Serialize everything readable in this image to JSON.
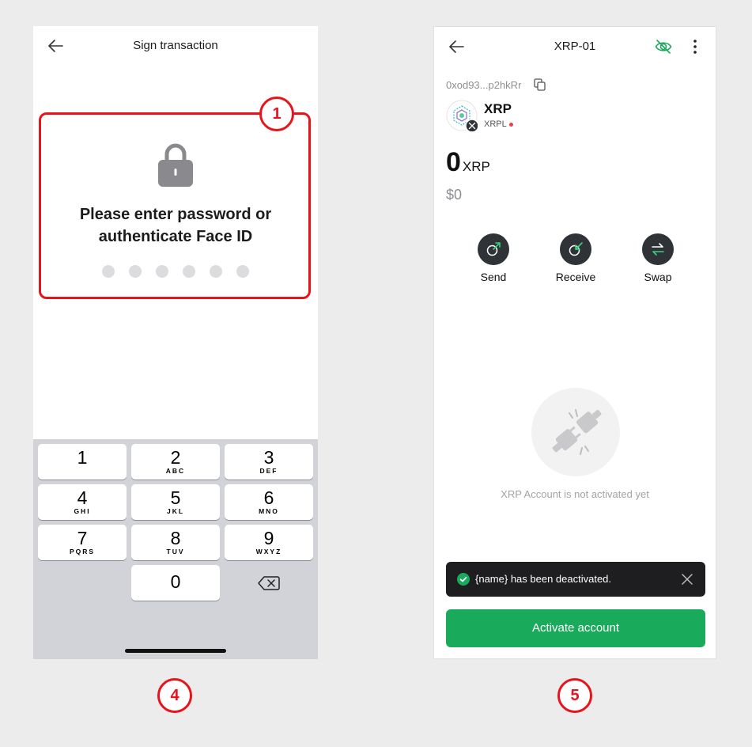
{
  "colors": {
    "accent_red": "#e8141c",
    "activate_green": "#1aaa5c",
    "toast_bg": "#1e1e20",
    "action_circle": "#2f3236",
    "muted_text": "#8e8e93"
  },
  "callouts": {
    "one": "1",
    "four": "4",
    "five": "5"
  },
  "sign_screen": {
    "title": "Sign transaction",
    "back_icon": "arrow-left-icon",
    "lock_icon": "lock-icon",
    "message": "Please enter password or authenticate Face ID",
    "pin_dot_count": 6,
    "keypad": [
      {
        "num": "1",
        "letters": ""
      },
      {
        "num": "2",
        "letters": "ABC"
      },
      {
        "num": "3",
        "letters": "DEF"
      },
      {
        "num": "4",
        "letters": "GHI"
      },
      {
        "num": "5",
        "letters": "JKL"
      },
      {
        "num": "6",
        "letters": "MNO"
      },
      {
        "num": "7",
        "letters": "PQRS"
      },
      {
        "num": "8",
        "letters": "TUV"
      },
      {
        "num": "9",
        "letters": "WXYZ"
      },
      {
        "num": "0",
        "letters": ""
      }
    ],
    "delete_icon": "backspace-icon"
  },
  "account_screen": {
    "title": "XRP-01",
    "address": "0xod93...p2hkRr",
    "token": {
      "name": "XRP",
      "chain": "XRPL"
    },
    "balance": {
      "amount": "0",
      "unit": "XRP",
      "fiat": "$0"
    },
    "actions": [
      {
        "label": "Send",
        "icon": "send-icon"
      },
      {
        "label": "Receive",
        "icon": "receive-icon"
      },
      {
        "label": "Swap",
        "icon": "swap-icon"
      }
    ],
    "empty_state": "XRP Account is not activated yet",
    "toast": "{name} has been deactivated.",
    "activate_button": "Activate account"
  }
}
